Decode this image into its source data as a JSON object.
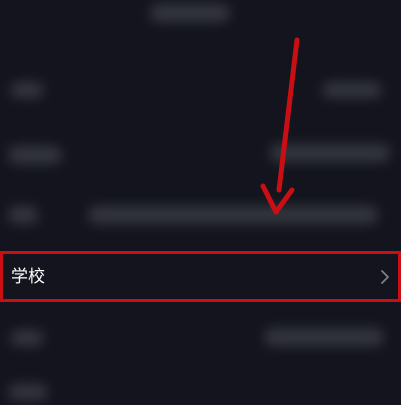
{
  "settings": {
    "school_row": {
      "label": "学校"
    }
  },
  "colors": {
    "background": "#13141d",
    "highlight": "#c90f14",
    "arrow": "#c90f14"
  },
  "icons": {
    "row_chevron": "chevron-right-icon",
    "annotation": "arrow-down-icon"
  }
}
